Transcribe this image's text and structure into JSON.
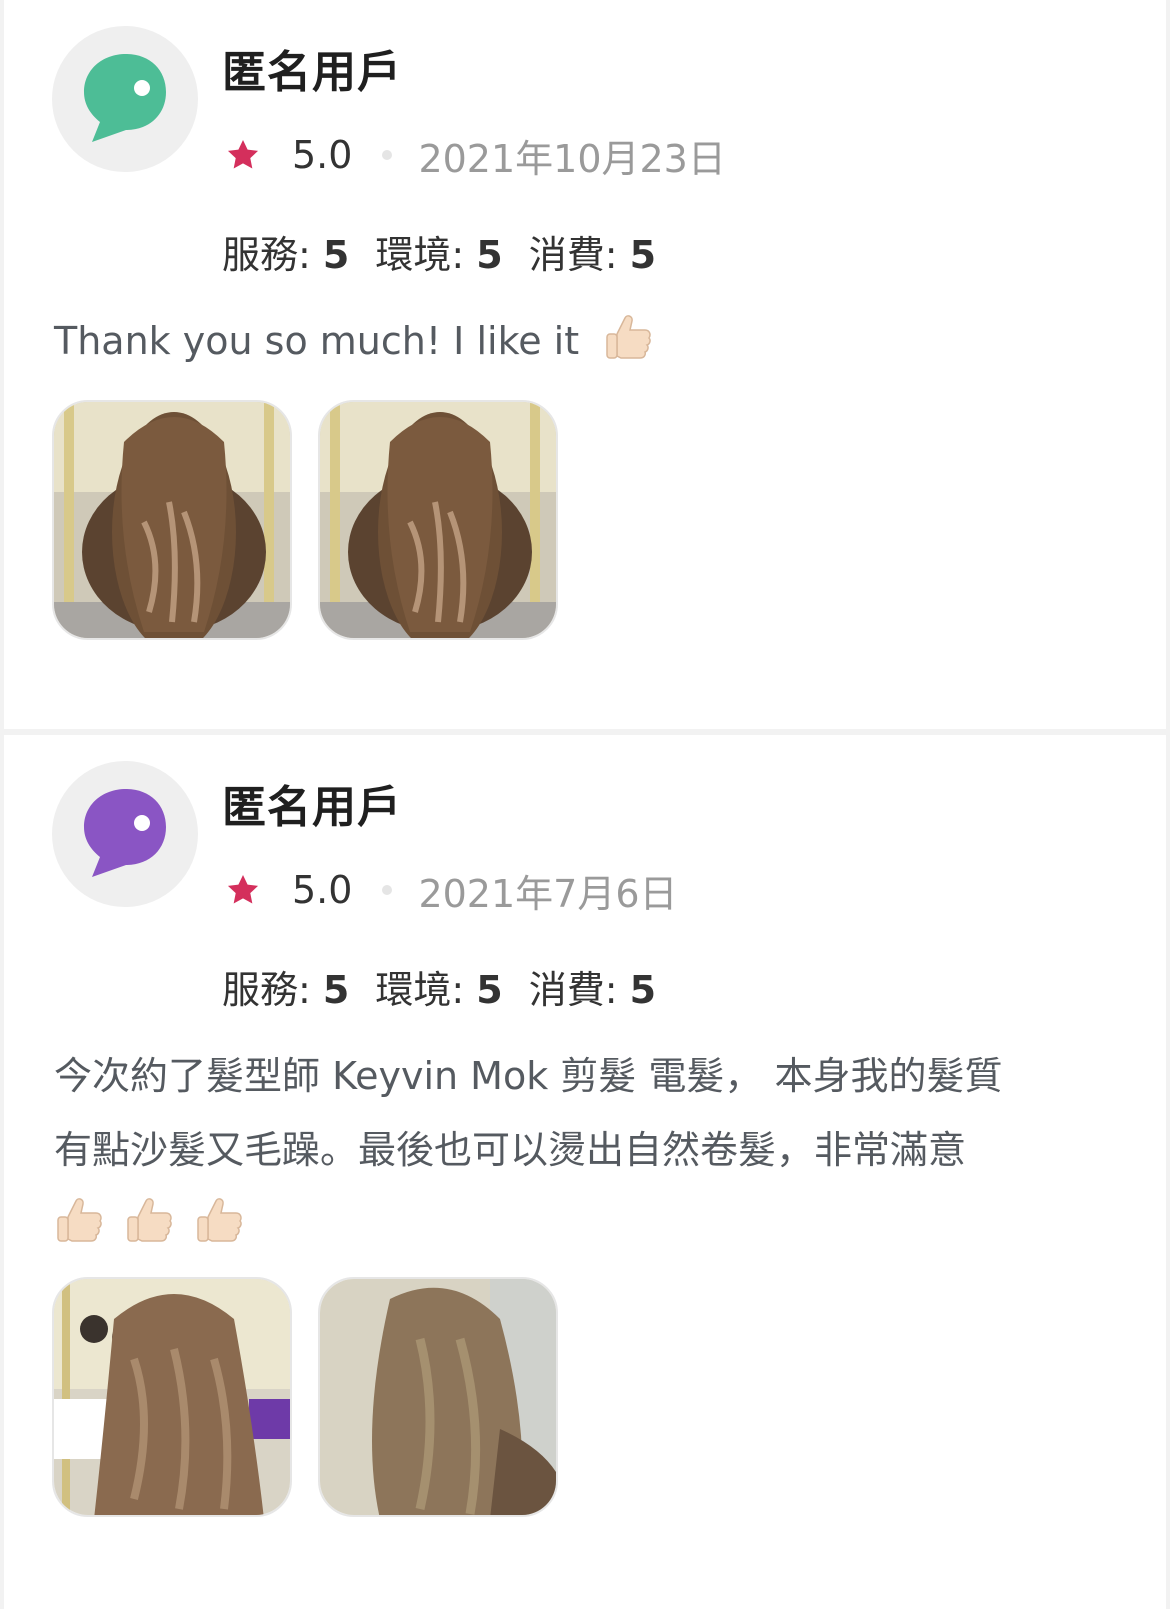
{
  "reviews": [
    {
      "avatar_icon": "chat-bubble-icon",
      "avatar_color": "#4dbd96",
      "username": "匿名用戶",
      "rating": "5.0",
      "date": "2021年10月23日",
      "subscores": [
        {
          "label": "服務:",
          "value": "5"
        },
        {
          "label": "環境:",
          "value": "5"
        },
        {
          "label": "消費:",
          "value": "5"
        }
      ],
      "comment_lines": [
        "Thank you so much! I like it"
      ],
      "photos": [
        "review-photo-long-wavy-hair",
        "review-photo-long-wavy-hair"
      ]
    },
    {
      "avatar_icon": "chat-bubble-icon",
      "avatar_color": "#8a55c4",
      "username": "匿名用戶",
      "rating": "5.0",
      "date": "2021年7月6日",
      "subscores": [
        {
          "label": "服務:",
          "value": "5"
        },
        {
          "label": "環境:",
          "value": "5"
        },
        {
          "label": "消費:",
          "value": "5"
        }
      ],
      "comment_lines": [
        "今次約了髮型師 Keyvin Mok 剪髮 電髮， 本身我的髮質",
        "有點沙髮又毛躁。最後也可以燙出自然卷髮，非常滿意"
      ],
      "photos": [
        "review-photo-wavy-hair-salon",
        "review-photo-wavy-hair-side"
      ]
    }
  ],
  "colors": {
    "star": "#d42f5c",
    "date": "#9a9a9a",
    "text": "#555a60"
  }
}
